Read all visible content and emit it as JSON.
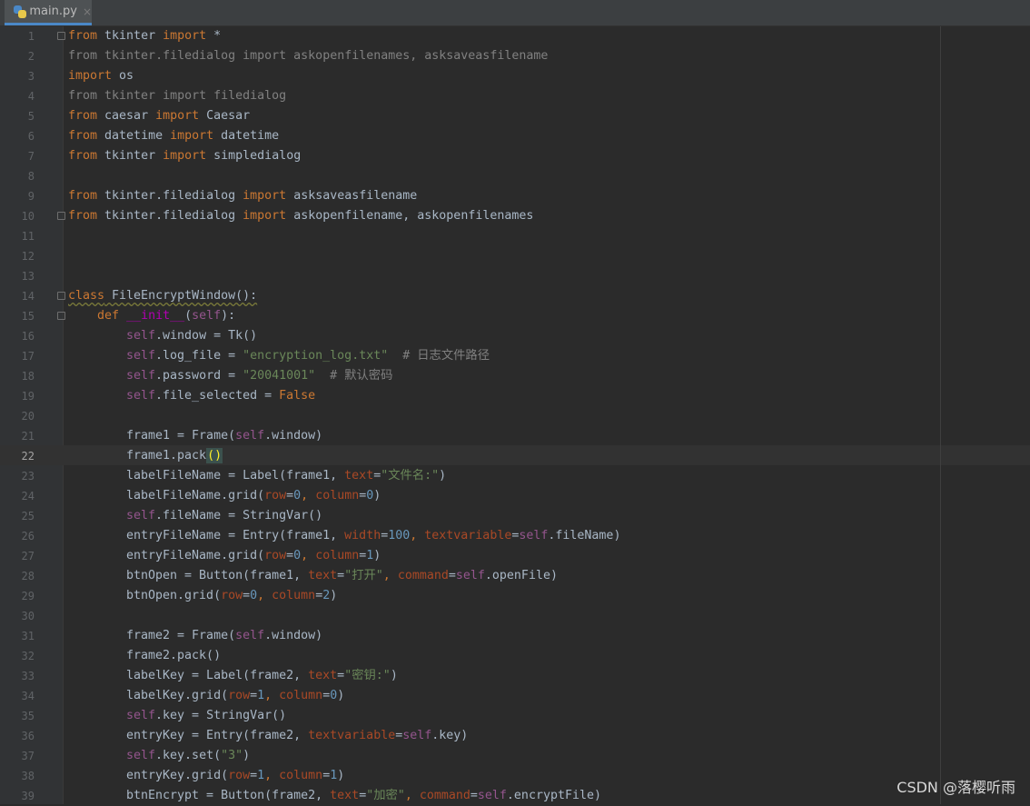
{
  "tab": {
    "filename": "main.py",
    "close": "×"
  },
  "active_line": 22,
  "lines": [
    {
      "n": "1"
    },
    {
      "n": "2"
    },
    {
      "n": "3"
    },
    {
      "n": "4"
    },
    {
      "n": "5"
    },
    {
      "n": "6"
    },
    {
      "n": "7"
    },
    {
      "n": "8"
    },
    {
      "n": "9"
    },
    {
      "n": "10"
    },
    {
      "n": "11"
    },
    {
      "n": "12"
    },
    {
      "n": "13"
    },
    {
      "n": "14"
    },
    {
      "n": "15"
    },
    {
      "n": "16"
    },
    {
      "n": "17"
    },
    {
      "n": "18"
    },
    {
      "n": "19"
    },
    {
      "n": "20"
    },
    {
      "n": "21"
    },
    {
      "n": "22"
    },
    {
      "n": "23"
    },
    {
      "n": "24"
    },
    {
      "n": "25"
    },
    {
      "n": "26"
    },
    {
      "n": "27"
    },
    {
      "n": "28"
    },
    {
      "n": "29"
    },
    {
      "n": "30"
    },
    {
      "n": "31"
    },
    {
      "n": "32"
    },
    {
      "n": "33"
    },
    {
      "n": "34"
    },
    {
      "n": "35"
    },
    {
      "n": "36"
    },
    {
      "n": "37"
    },
    {
      "n": "38"
    },
    {
      "n": "39"
    }
  ],
  "code": {
    "l1_kw1": "from",
    "l1_mod": " tkinter ",
    "l1_kw2": "import",
    "l1_rest": " *",
    "l2": "from tkinter.filedialog import askopenfilenames, asksaveasfilename",
    "l3_kw": "import",
    "l3_rest": " os",
    "l4": "from tkinter import filedialog",
    "l5_kw1": "from",
    "l5_mod": " caesar ",
    "l5_kw2": "import",
    "l5_rest": " Caesar",
    "l6_kw1": "from",
    "l6_mod": " datetime ",
    "l6_kw2": "import",
    "l6_rest": " datetime",
    "l7_kw1": "from",
    "l7_mod": " tkinter ",
    "l7_kw2": "import",
    "l7_rest": " simpledialog",
    "l9_kw1": "from",
    "l9_mod": " tkinter.filedialog ",
    "l9_kw2": "import",
    "l9_rest": " asksaveasfilename",
    "l10_kw1": "from",
    "l10_mod": " tkinter.filedialog ",
    "l10_kw2": "import",
    "l10_rest": " askopenfilename, askopenfilenames",
    "l14_kw": "class",
    "l14_name": " FileEncryptWindow():",
    "l15_indent": "    ",
    "l15_kw": "def",
    "l15_name": " __init__",
    "l15_p1": "(",
    "l15_self": "self",
    "l15_p2": "):",
    "l16_self": "self",
    "l16_rest": ".window = Tk()",
    "l17_self": "self",
    "l17_mid": ".log_file = ",
    "l17_str": "\"encryption_log.txt\"",
    "l17_cm": "  # 日志文件路径",
    "l18_self": "self",
    "l18_mid": ".password = ",
    "l18_str": "\"20041001\"",
    "l18_cm": "  # 默认密码",
    "l19_self": "self",
    "l19_mid": ".file_selected = ",
    "l19_kw": "False",
    "l21_a": "frame1 = Frame(",
    "l21_self": "self",
    "l21_b": ".window)",
    "l22_a": "frame1.pack",
    "l22_brk": "()",
    "l23_a": "labelFileName = Label(frame1, ",
    "l23_p": "text",
    "l23_eq": "=",
    "l23_str": "\"文件名:\"",
    "l23_b": ")",
    "l24_a": "labelFileName.grid(",
    "l24_p1": "row",
    "l24_eq1": "=",
    "l24_n1": "0",
    "l24_c": ", ",
    "l24_p2": "column",
    "l24_eq2": "=",
    "l24_n2": "0",
    "l24_b": ")",
    "l25_self": "self",
    "l25_rest": ".fileName = StringVar()",
    "l26_a": "entryFileName = Entry(frame1, ",
    "l26_p1": "width",
    "l26_eq1": "=",
    "l26_n1": "100",
    "l26_c": ", ",
    "l26_p2": "textvariable",
    "l26_eq2": "=",
    "l26_self": "self",
    "l26_b": ".fileName)",
    "l27_a": "entryFileName.grid(",
    "l27_p1": "row",
    "l27_eq1": "=",
    "l27_n1": "0",
    "l27_c": ", ",
    "l27_p2": "column",
    "l27_eq2": "=",
    "l27_n2": "1",
    "l27_b": ")",
    "l28_a": "btnOpen = Button(frame1, ",
    "l28_p1": "text",
    "l28_eq1": "=",
    "l28_str": "\"打开\"",
    "l28_c": ", ",
    "l28_p2": "command",
    "l28_eq2": "=",
    "l28_self": "self",
    "l28_b": ".openFile)",
    "l29_a": "btnOpen.grid(",
    "l29_p1": "row",
    "l29_eq1": "=",
    "l29_n1": "0",
    "l29_c": ", ",
    "l29_p2": "column",
    "l29_eq2": "=",
    "l29_n2": "2",
    "l29_b": ")",
    "l31_a": "frame2 = Frame(",
    "l31_self": "self",
    "l31_b": ".window)",
    "l32_a": "frame2.pack()",
    "l33_a": "labelKey = Label(frame2, ",
    "l33_p": "text",
    "l33_eq": "=",
    "l33_str": "\"密钥:\"",
    "l33_b": ")",
    "l34_a": "labelKey.grid(",
    "l34_p1": "row",
    "l34_eq1": "=",
    "l34_n1": "1",
    "l34_c": ", ",
    "l34_p2": "column",
    "l34_eq2": "=",
    "l34_n2": "0",
    "l34_b": ")",
    "l35_self": "self",
    "l35_rest": ".key = StringVar()",
    "l36_a": "entryKey = Entry(frame2, ",
    "l36_p": "textvariable",
    "l36_eq": "=",
    "l36_self": "self",
    "l36_b": ".key)",
    "l37_self": "self",
    "l37_a": ".key.set(",
    "l37_str": "\"3\"",
    "l37_b": ")",
    "l38_a": "entryKey.grid(",
    "l38_p1": "row",
    "l38_eq1": "=",
    "l38_n1": "1",
    "l38_c": ", ",
    "l38_p2": "column",
    "l38_eq2": "=",
    "l38_n2": "1",
    "l38_b": ")",
    "l39_a": "btnEncrypt = Button(frame2, ",
    "l39_p1": "text",
    "l39_eq1": "=",
    "l39_str": "\"加密\"",
    "l39_c": ", ",
    "l39_p2": "command",
    "l39_eq2": "=",
    "l39_self": "self",
    "l39_b": ".encryptFile)"
  },
  "watermark": "CSDN @落樱听雨",
  "colors": {
    "background": "#2b2b2b",
    "gutter": "#313335",
    "keyword": "#cc7832",
    "string": "#6a8759",
    "number": "#6897bb",
    "self": "#94558d",
    "comment": "#808080",
    "param": "#aa4926",
    "text": "#a9b7c6"
  }
}
